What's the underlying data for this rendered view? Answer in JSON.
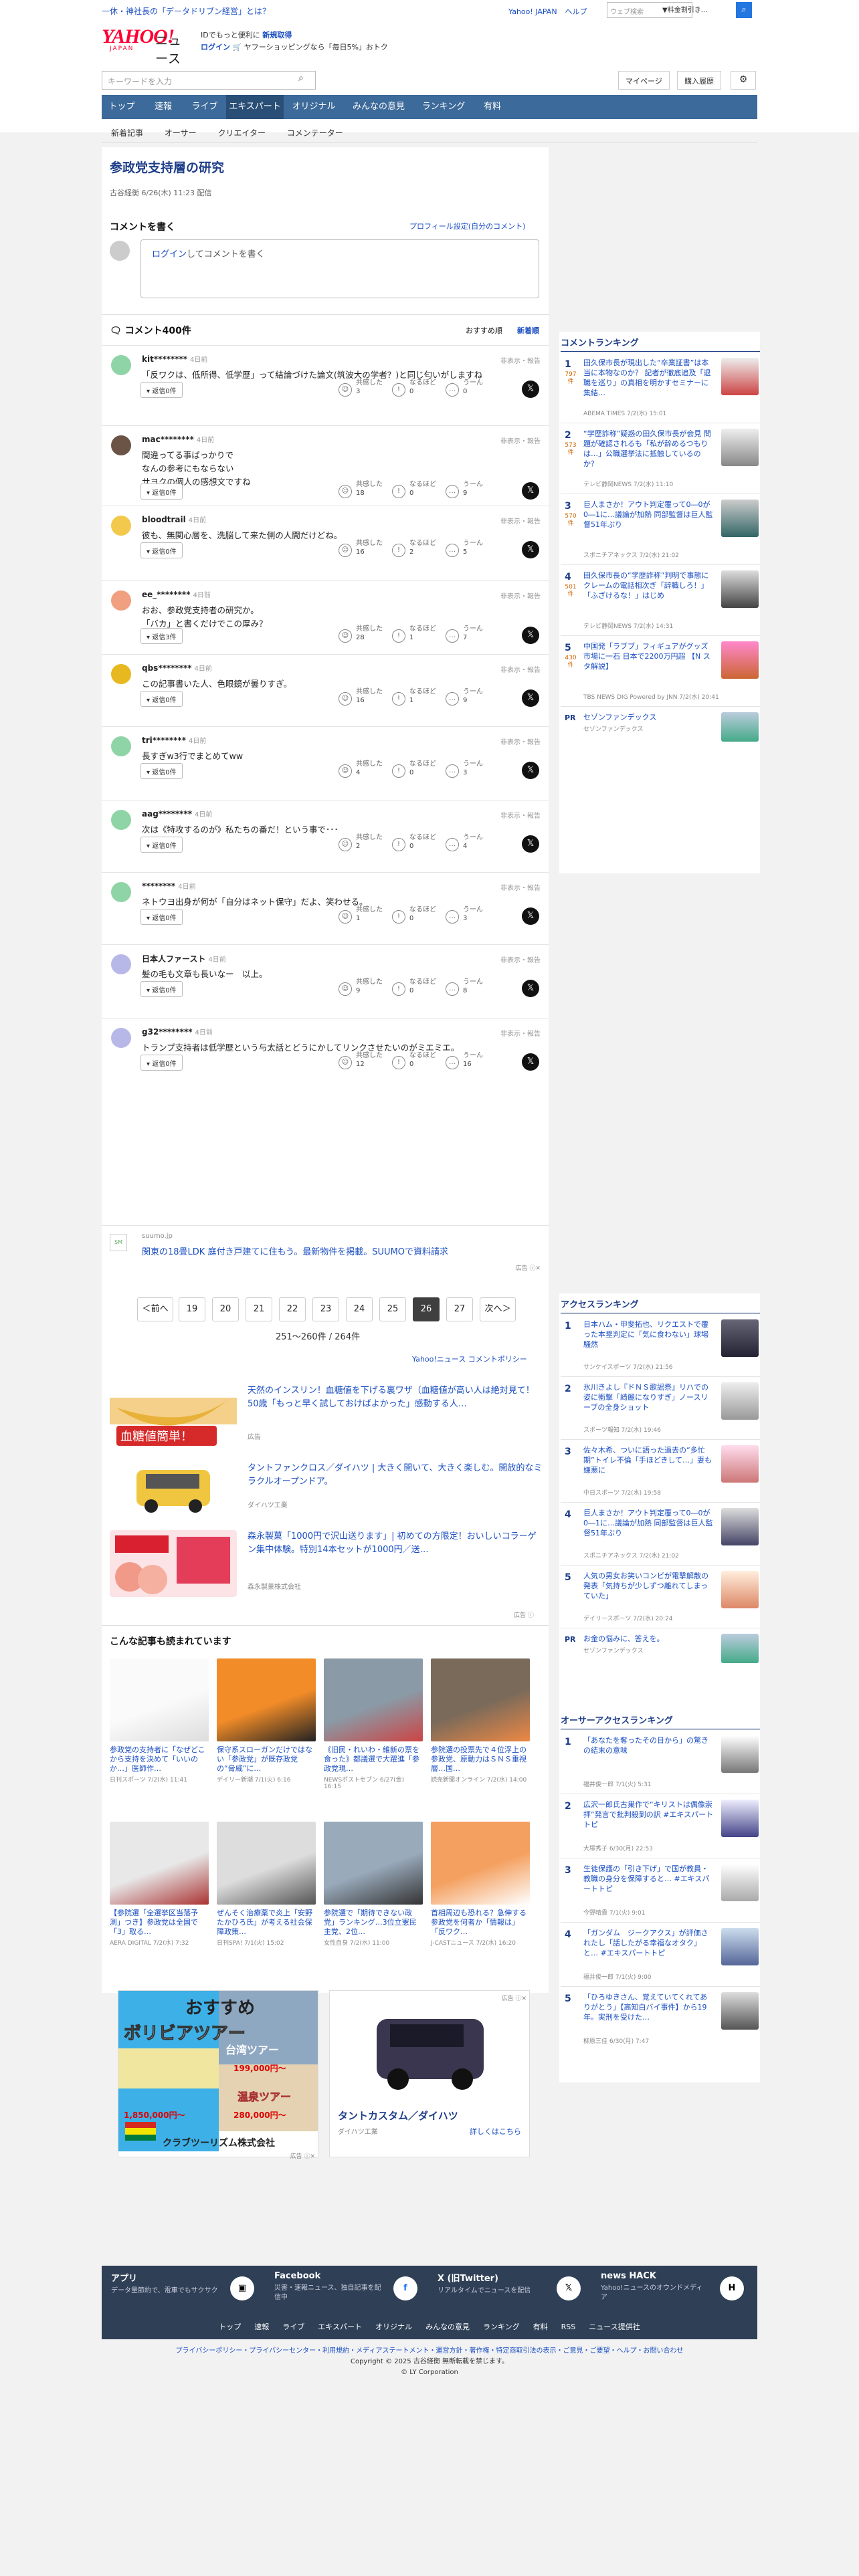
{
  "mast": {
    "promo": "一休・神社長の「データドリブン経営」とは？",
    "links": [
      "Yahoo! JAPAN",
      "ヘルプ"
    ],
    "search_placeholder": "ウェブ検索",
    "search_select": "▼料金割引き..."
  },
  "logo": {
    "main": "YAHOO!",
    "sub": "JAPAN",
    "news": "ニュース"
  },
  "header": {
    "line1": "IDでもっと便利に",
    "signup": "新規取得",
    "login": "ログイン",
    "line2": "ヤフーショッピングなら「毎日5%」おトク"
  },
  "search": {
    "placeholder": "キーワードを入力"
  },
  "rbuttons": [
    "マイページ",
    "購入履歴"
  ],
  "nav": [
    "トップ",
    "速報",
    "ライブ",
    "エキスパート",
    "オリジナル",
    "みんなの意見",
    "ランキング",
    "有料"
  ],
  "nav_active": 3,
  "subnav": [
    "新着記事",
    "オーサー",
    "クリエイター",
    "コメンテーター"
  ],
  "article": {
    "title": "参政党支持層の研究",
    "meta": "古谷経衡 6/26(木) 11:23 配信"
  },
  "comment_form": {
    "heading": "コメントを書く",
    "profile_link": "プロフィール設定(自分のコメント)",
    "prompt_login": "ログイン",
    "prompt_rest": "してコメントを書く"
  },
  "comment_list": {
    "heading": "コメント400件",
    "sort": [
      "おすすめ順",
      "新着順"
    ]
  },
  "comments": [
    {
      "user": "kit********",
      "time": "4日前",
      "report": "非表示・報告",
      "body": "「反ワクは、低所得、低学歴」って結論づけた論文(筑波大の学者？)と同じ匂いがしますね",
      "reply": "返信0件",
      "r": [
        3,
        0,
        0
      ],
      "avatar": "#8fd4a6"
    },
    {
      "user": "mac********",
      "time": "4日前",
      "report": "非表示・報告",
      "body": "間違ってる事ばっかりで\nなんの参考にもならない\nサヨクの個人の感想文ですね",
      "reply": "返信0件",
      "r": [
        18,
        0,
        9
      ],
      "avatar": "#6b5346"
    },
    {
      "user": "bloodtrail",
      "time": "4日前",
      "report": "非表示・報告",
      "body": "彼も、無関心層を、洗脳して来た側の人間だけどね。",
      "reply": "返信0件",
      "r": [
        16,
        2,
        5
      ],
      "avatar": "#f2c94c"
    },
    {
      "user": "ee_********",
      "time": "4日前",
      "report": "非表示・報告",
      "body": "おお、参政党支持者の研究か。\n「バカ」と書くだけでこの厚み？",
      "reply": "返信3件",
      "r": [
        28,
        1,
        7
      ],
      "avatar": "#f0a080"
    },
    {
      "user": "qbs********",
      "time": "4日前",
      "report": "非表示・報告",
      "body": "この記事書いた人、色眼鏡が曇りすぎ。",
      "reply": "返信0件",
      "r": [
        16,
        1,
        9
      ],
      "avatar": "#e8b820"
    },
    {
      "user": "tri********",
      "time": "4日前",
      "report": "非表示・報告",
      "body": "長すぎw3行でまとめてww",
      "reply": "返信0件",
      "r": [
        4,
        0,
        3
      ],
      "avatar": "#8fd4a6"
    },
    {
      "user": "aag********",
      "time": "4日前",
      "report": "非表示・報告",
      "body": "次は《特攻するのが》私たちの番だ！という事で･･･",
      "reply": "返信0件",
      "r": [
        2,
        0,
        4
      ],
      "avatar": "#8fd4a6"
    },
    {
      "user": "********",
      "time": "4日前",
      "report": "非表示・報告",
      "body": "ネトウヨ出身が何が「自分はネット保守」だよ、笑わせる。",
      "reply": "返信0件",
      "r": [
        1,
        0,
        3
      ],
      "avatar": "#8fd4a6"
    },
    {
      "user": "日本人ファースト",
      "time": "4日前",
      "report": "非表示・報告",
      "body": "髪の毛も文章も長いなー　以上。",
      "reply": "返信0件",
      "r": [
        9,
        0,
        8
      ],
      "avatar": "#b8b8e8"
    },
    {
      "user": "g32********",
      "time": "4日前",
      "report": "非表示・報告",
      "body": "トランプ支持者は低学歴という与太話とどうにかしてリンクさせたいのがミエミエ。",
      "reply": "返信0件",
      "r": [
        12,
        0,
        16
      ],
      "avatar": "#b8b8e8"
    }
  ],
  "reactions": {
    "a": "共感した",
    "b": "なるほど",
    "c": "うーん"
  },
  "ad1": {
    "source": "suumo.jp",
    "text": "関東の18畳LDK 庭付き戸建てに住もう。最新物件を掲載。SUUMOで資料請求",
    "mark": "広告"
  },
  "pagination": {
    "prev": "＜前へ",
    "pages": [
      "19",
      "20",
      "21",
      "22",
      "23",
      "24",
      "25",
      "26",
      "27"
    ],
    "current": "26",
    "next": "次へ＞",
    "info": "251〜260件 / 264件",
    "policy": "Yahoo!ニュース コメントポリシー"
  },
  "ads": [
    {
      "text": "天然のインスリン！血糖値を下げる裏ワザ（血糖値が高い人は絶対見て！50歳「もっと早く試しておけばよかった」感動する人…",
      "sponsor": "広告",
      "badge": "血糖値簡単！"
    },
    {
      "text": "タントファンクロス／ダイハツ | 大きく開いて、大きく楽しむ。開放的なミラクルオープンドア。",
      "sponsor": "ダイハツ工業"
    },
    {
      "text": "森永製菓「1000円で沢山送ります」| 初めての方限定！おいしいコラーゲン集中体験。特別14本セットが1000円／送…",
      "sponsor": "森永製菓株式会社"
    }
  ],
  "ads_mark": "広告",
  "recommend": {
    "heading": "こんな記事も読まれています",
    "cards": [
      {
        "t": "参政党の支持者に「なぜどこから支持を決めて「いいのか…」医師作…",
        "s": "日刊スポーツ 7/2(水) 11:41"
      },
      {
        "t": "保守系スローガンだけではない「参政党」が既存政党の“脅威”に…",
        "s": "デイリー新潮 7/1(火) 6:16"
      },
      {
        "t": "《旧民・れいわ・維新の票を食った》都議選で大躍進「参政党現…",
        "s": "NEWSポストセブン 6/27(金) 16:15"
      },
      {
        "t": "参院選の投票先で４位浮上の参政党、原動力はＳＮＳ重視層…国…",
        "s": "読売新聞オンライン 7/2(水) 14:00"
      },
      {
        "t": "【参院選「全選挙区当落予測」つき】参政党は全国で「3」取る…",
        "s": "AERA DIGITAL 7/2(水) 7:32"
      },
      {
        "t": "ぜんそく治療薬で炎上「安野たかひろ氏」が考える社会保障政策…",
        "s": "日刊SPA! 7/1(火) 15:02"
      },
      {
        "t": "参院選で「期待できない政党」ランキング…3位立憲民主党、2位…",
        "s": "女性自身 7/2(水) 11:00"
      },
      {
        "t": "首相周辺も恐れる？急伸する参政党を何者か「情報は」「反ワク…",
        "s": "J-CASTニュース 7/2(水) 16:20"
      }
    ]
  },
  "bigads": [
    {
      "t1": "おすすめ",
      "t2": "ボリビアツアー",
      "t3": "台湾ツアー",
      "p1": "199,000円〜",
      "t4": "温泉ツアー",
      "p2": "280,000円〜",
      "p3": "1,850,000円〜",
      "brand": "クラブツーリズム株式会社",
      "mark": "広告"
    },
    {
      "title": "タントカスタム／ダイハツ",
      "sub": "ダイハツ工業",
      "link": "詳しくはこちら",
      "mark": "広告"
    }
  ],
  "rank_comment": {
    "heading": "コメントランキング",
    "items": [
      {
        "n": "1",
        "c": "797件",
        "t": "田久保市長が現出した“卒業証書”は本当に本物なのか？ 記者が徹底追及「退職を巡り」の真相を明かすセミナーに集結…",
        "s": "ABEMA TIMES 7/2(水) 15:01"
      },
      {
        "n": "2",
        "c": "573件",
        "t": "“学歴詐称”疑惑の田久保市長が会見 問題が確認されるも「私が辞めるつもりは…」公職選挙法に抵触しているのか？",
        "s": "テレビ静岡NEWS 7/2(水) 11:10"
      },
      {
        "n": "3",
        "c": "570件",
        "t": "巨人まさか！アウト判定覆って0―0が0―1に…議論が加熱 同部監督は巨人監督51年ぶり",
        "s": "スポニチアネックス 7/2(水) 21:02"
      },
      {
        "n": "4",
        "c": "501件",
        "t": "田久保市長の“学歴詐称”判明で事態にクレームの電話相次ぎ「辞職しろ！」「ふざけるな！」はじめ",
        "s": "テレビ静岡NEWS 7/2(水) 14:31"
      },
      {
        "n": "5",
        "c": "430件",
        "t": "中国発「ラブブ」フィギュアがグッズ市場に一石 日本で2200万円超 【N スタ解説】",
        "s": "TBS NEWS DIG Powered by JNN 7/2(水) 20:41"
      }
    ],
    "pr": {
      "tag": "PR",
      "t": "セゾンファンデックス",
      "s": "セゾンファンデックス"
    }
  },
  "rank_access": {
    "heading": "アクセスランキング",
    "items": [
      {
        "n": "1",
        "t": "日本ハム・甲斐拓也、リクエストで覆った本塁判定に「気に食わない」球場騒然",
        "s": "サンケイスポーツ 7/2(水) 21:56"
      },
      {
        "n": "2",
        "t": "氷川きよし『ドＮＳ歌謡祭』リハでの姿に衝撃「綺麗になりすぎ」ノースリーブの全身ショット",
        "s": "スポーツ報知 7/2(水) 19:46"
      },
      {
        "n": "3",
        "t": "佐々木希、ついに語った過去の“多忙期”トイレ不倫「手ほどきして…」妻も嫌悪に",
        "s": "中日スポーツ 7/2(水) 19:58"
      },
      {
        "n": "4",
        "t": "巨人まさか！アウト判定覆って0―0が0―1に…議論が加熱 同部監督は巨人監督51年ぶり",
        "s": "スポニチアネックス 7/2(水) 21:02"
      },
      {
        "n": "5",
        "t": "人気の男女お笑いコンビが電撃解散の発表「気持ちが少しずつ離れてしまっていた」",
        "s": "デイリースポーツ 7/2(水) 20:24"
      }
    ],
    "pr": {
      "tag": "PR",
      "t": "お金の悩みに、答えを。",
      "s": "セゾンファンデックス"
    }
  },
  "rank_author": {
    "heading": "オーサーアクセスランキング",
    "items": [
      {
        "n": "1",
        "t": "「あなたを奪ったその日から」の驚きの結末の意味",
        "s": "福井俊一郎 7/1(火) 5:31"
      },
      {
        "n": "2",
        "t": "広沢一郎氏古巣作で“キリストは偶像崇拝”発言で批判殺到の訳 #エキスパートトピ",
        "s": "大塚秀子 6/30(月) 22:53"
      },
      {
        "n": "3",
        "t": "生徒保護の「引き下げ」で国が教員・教職の身分を保障すると… #エキスパートトピ",
        "s": "今野晴貴 7/1(火) 9:01"
      },
      {
        "n": "4",
        "t": "「ガンダム　ジークアクス」が評価されたし「話したがる幸福なオタク」と… #エキスパートトピ",
        "s": "福井俊一郎 7/1(火) 9:00"
      },
      {
        "n": "5",
        "t": "「ひろゆきさん、覚えていてくれてありがとう」【高知白バイ事件】から19年。実刑を受けた…",
        "s": "柳原三佳 6/30(月) 7:47"
      }
    ]
  },
  "footer": {
    "cols": [
      {
        "h": "アプリ",
        "d": "データ量節約で、電車でもサクサク"
      },
      {
        "h": "Facebook",
        "d": "災害・速報ニュース、独自記事を配信中"
      },
      {
        "h": "X (旧Twitter)",
        "d": "リアルタイムでニュースを配信"
      },
      {
        "h": "news HACK",
        "d": "Yahoo!ニュースのオウンドメディア"
      }
    ],
    "nav": [
      "トップ",
      "速報",
      "ライブ",
      "エキスパート",
      "オリジナル",
      "みんなの意見",
      "ランキング",
      "有料",
      "RSS",
      "ニュース提供社"
    ],
    "legal": "プライバシーポリシー・プライバシーセンター・利用規約・メディアステートメント・運営方針・著作権・特定商取引法の表示・ご意見・ご要望・ヘルプ・お問い合わせ",
    "copyright": "Copyright © 2025 古谷経衡 無断転載を禁じます。",
    "ly": "© LY Corporation"
  },
  "colors": {
    "nav": "#3c6a9a",
    "title": "#1f3e89",
    "link": "#1a4ec2"
  }
}
